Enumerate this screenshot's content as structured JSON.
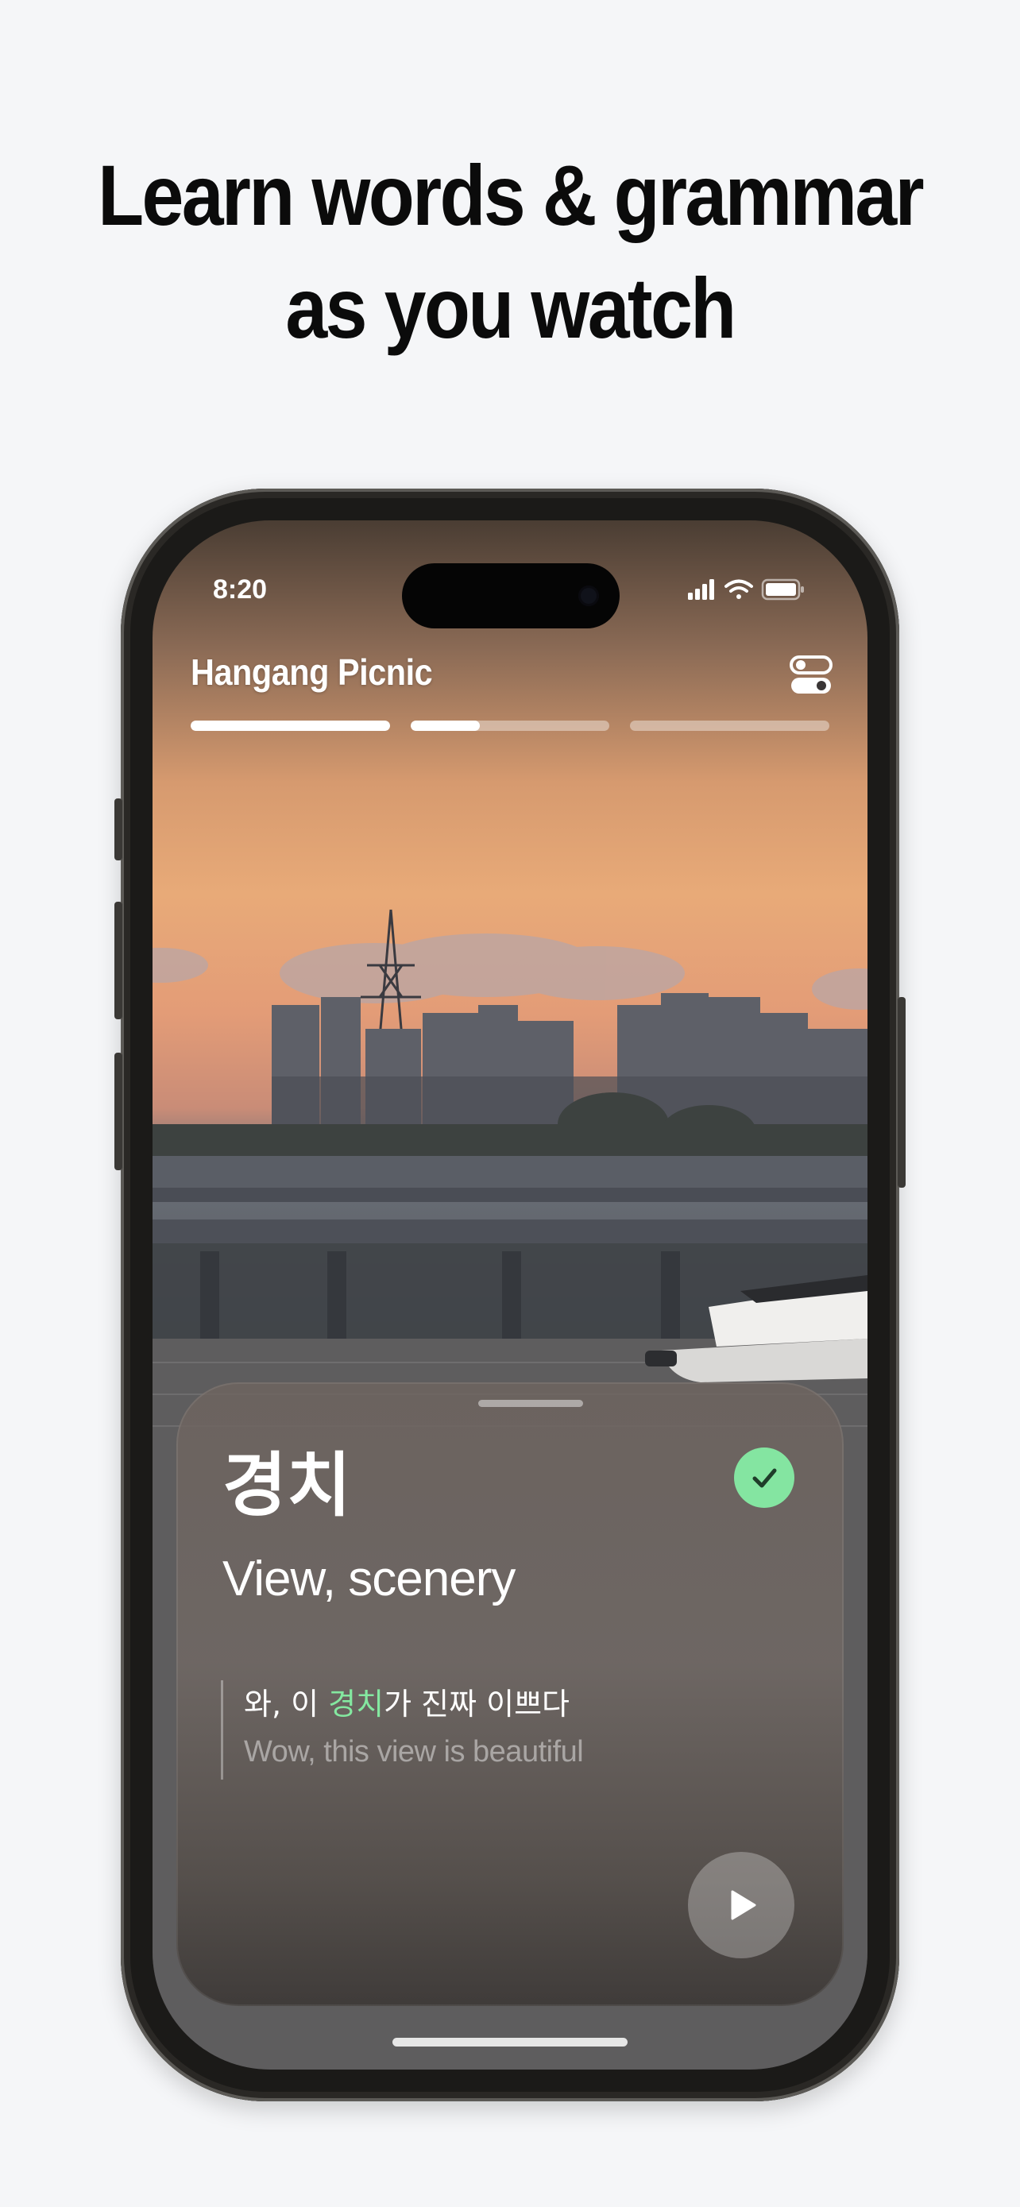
{
  "headline": {
    "line1": "Learn words & grammar",
    "line2": "as you watch"
  },
  "status_bar": {
    "time": "8:20"
  },
  "story": {
    "title": "Hangang Picnic",
    "progress": [
      1.0,
      0.35,
      0.0
    ]
  },
  "card": {
    "word": "경치",
    "meaning": "View, scenery",
    "example_before": "와, 이 ",
    "example_highlight": "경치",
    "example_after": "가 진짜 이쁘다",
    "example_translation": "Wow, this view is beautiful",
    "known": true
  },
  "colors": {
    "accent_green": "#84e5a1",
    "background": "#f5f6f8"
  },
  "icons": [
    "signal-icon",
    "wifi-icon",
    "battery-icon",
    "settings-toggle-icon",
    "check-icon",
    "play-icon"
  ]
}
